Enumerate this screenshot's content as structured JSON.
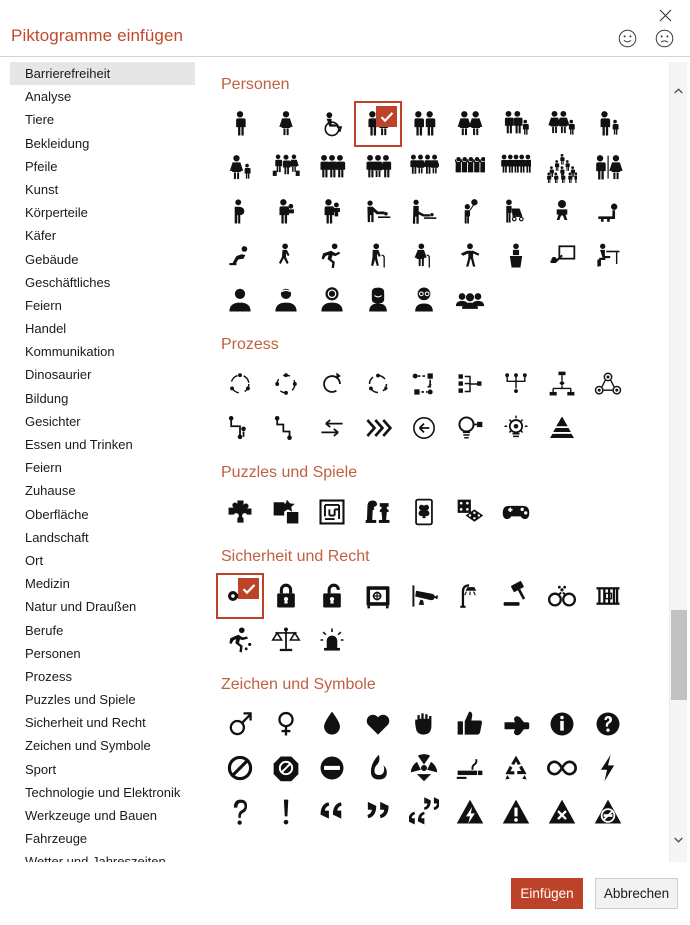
{
  "dialog": {
    "title": "Piktogramme einfügen",
    "close_icon": "close-icon",
    "feedback_happy_icon": "smiley-happy-icon",
    "feedback_sad_icon": "smiley-sad-icon",
    "accent_color": "#C0492B",
    "selection_color": "#BC4328",
    "selected_sidebar_bg": "#e6e6e6"
  },
  "sidebar": {
    "items": [
      {
        "label": "Barrierefreiheit",
        "selected": true
      },
      {
        "label": "Analyse",
        "selected": false
      },
      {
        "label": "Tiere",
        "selected": false
      },
      {
        "label": "Bekleidung",
        "selected": false
      },
      {
        "label": "Pfeile",
        "selected": false
      },
      {
        "label": "Kunst",
        "selected": false
      },
      {
        "label": "Körperteile",
        "selected": false
      },
      {
        "label": "Käfer",
        "selected": false
      },
      {
        "label": "Gebäude",
        "selected": false
      },
      {
        "label": "Geschäftliches",
        "selected": false
      },
      {
        "label": "Feiern",
        "selected": false
      },
      {
        "label": "Handel",
        "selected": false
      },
      {
        "label": "Kommunikation",
        "selected": false
      },
      {
        "label": "Dinosaurier",
        "selected": false
      },
      {
        "label": "Bildung",
        "selected": false
      },
      {
        "label": "Gesichter",
        "selected": false
      },
      {
        "label": "Essen und Trinken",
        "selected": false
      },
      {
        "label": "Feiern",
        "selected": false
      },
      {
        "label": "Zuhause",
        "selected": false
      },
      {
        "label": "Oberfläche",
        "selected": false
      },
      {
        "label": "Landschaft",
        "selected": false
      },
      {
        "label": "Ort",
        "selected": false
      },
      {
        "label": "Medizin",
        "selected": false
      },
      {
        "label": "Natur und Draußen",
        "selected": false
      },
      {
        "label": "Berufe",
        "selected": false
      },
      {
        "label": "Personen",
        "selected": false
      },
      {
        "label": "Prozess",
        "selected": false
      },
      {
        "label": "Puzzles und Spiele",
        "selected": false
      },
      {
        "label": "Sicherheit und Recht",
        "selected": false
      },
      {
        "label": "Zeichen und Symbole",
        "selected": false
      },
      {
        "label": "Sport",
        "selected": false
      },
      {
        "label": "Technologie und Elektronik",
        "selected": false
      },
      {
        "label": "Werkzeuge und Bauen",
        "selected": false
      },
      {
        "label": "Fahrzeuge",
        "selected": false
      },
      {
        "label": "Wetter und Jahreszeiten",
        "selected": false
      }
    ]
  },
  "sections": [
    {
      "title": "Personen",
      "icons": [
        {
          "name": "person-standing-male-icon",
          "selected": false
        },
        {
          "name": "person-standing-female-icon",
          "selected": false
        },
        {
          "name": "person-wheelchair-icon",
          "selected": false
        },
        {
          "name": "couple-two-people-icon",
          "selected": true
        },
        {
          "name": "couple-two-men-icon",
          "selected": false
        },
        {
          "name": "couple-two-women-icon",
          "selected": false
        },
        {
          "name": "family-two-men-child-icon",
          "selected": false
        },
        {
          "name": "family-two-women-child-icon",
          "selected": false
        },
        {
          "name": "parent-and-child-icon",
          "selected": false
        },
        {
          "name": "mother-and-child-icon",
          "selected": false
        },
        {
          "name": "family-with-luggage-icon",
          "selected": false
        },
        {
          "name": "group-of-three-men-icon",
          "selected": false
        },
        {
          "name": "group-of-three-people-icon",
          "selected": false
        },
        {
          "name": "group-of-four-people-icon",
          "selected": false
        },
        {
          "name": "crowd-cheering-icon",
          "selected": false
        },
        {
          "name": "group-of-five-people-icon",
          "selected": false
        },
        {
          "name": "large-crowd-pyramid-icon",
          "selected": false
        },
        {
          "name": "restroom-male-female-icon",
          "selected": false
        },
        {
          "name": "pregnant-person-icon",
          "selected": false
        },
        {
          "name": "adult-holding-baby-icon",
          "selected": false
        },
        {
          "name": "adult-carrying-baby-icon",
          "selected": false
        },
        {
          "name": "changing-baby-diaper-icon",
          "selected": false
        },
        {
          "name": "caring-for-baby-table-icon",
          "selected": false
        },
        {
          "name": "child-with-balloon-icon",
          "selected": false
        },
        {
          "name": "person-pushing-stroller-icon",
          "selected": false
        },
        {
          "name": "baby-sitting-icon",
          "selected": false
        },
        {
          "name": "baby-crawling-icon",
          "selected": false
        },
        {
          "name": "person-crawling-icon",
          "selected": false
        },
        {
          "name": "person-walking-icon",
          "selected": false
        },
        {
          "name": "person-running-icon",
          "selected": false
        },
        {
          "name": "elderly-person-cane-icon",
          "selected": false
        },
        {
          "name": "elderly-woman-cane-icon",
          "selected": false
        },
        {
          "name": "person-arms-open-icon",
          "selected": false
        },
        {
          "name": "person-at-podium-icon",
          "selected": false
        },
        {
          "name": "presenter-with-board-icon",
          "selected": false
        },
        {
          "name": "person-at-desk-icon",
          "selected": false
        },
        {
          "name": "avatar-silhouette-icon",
          "selected": false
        },
        {
          "name": "avatar-man-icon",
          "selected": false
        },
        {
          "name": "avatar-woman-curly-icon",
          "selected": false
        },
        {
          "name": "avatar-woman-long-hair-icon",
          "selected": false
        },
        {
          "name": "avatar-man-glasses-icon",
          "selected": false
        },
        {
          "name": "avatar-group-icon",
          "selected": false
        }
      ]
    },
    {
      "title": "Prozess",
      "icons": [
        {
          "name": "cycle-three-dots-icon",
          "selected": false
        },
        {
          "name": "cycle-four-dots-icon",
          "selected": false
        },
        {
          "name": "refresh-circle-arrows-icon",
          "selected": false
        },
        {
          "name": "cycle-arrows-dots-icon",
          "selected": false
        },
        {
          "name": "process-flow-square-icon",
          "selected": false
        },
        {
          "name": "process-branch-icon",
          "selected": false
        },
        {
          "name": "process-merge-icon",
          "selected": false
        },
        {
          "name": "hierarchy-flow-icon",
          "selected": false
        },
        {
          "name": "network-nodes-icon",
          "selected": false
        },
        {
          "name": "path-zigzag-icon",
          "selected": false
        },
        {
          "name": "path-steps-icon",
          "selected": false
        },
        {
          "name": "exchange-arrows-icon",
          "selected": false
        },
        {
          "name": "fast-forward-chevrons-icon",
          "selected": false
        },
        {
          "name": "back-arrow-circle-icon",
          "selected": false
        },
        {
          "name": "lightbulb-plug-icon",
          "selected": false
        },
        {
          "name": "lightbulb-idea-icon",
          "selected": false
        },
        {
          "name": "pyramid-layers-icon",
          "selected": false
        }
      ]
    },
    {
      "title": "Puzzles und Spiele",
      "icons": [
        {
          "name": "puzzle-pieces-icon",
          "selected": false
        },
        {
          "name": "puzzle-assembly-icon",
          "selected": false
        },
        {
          "name": "maze-icon",
          "selected": false
        },
        {
          "name": "chess-pieces-icon",
          "selected": false
        },
        {
          "name": "playing-card-icon",
          "selected": false
        },
        {
          "name": "dice-icon",
          "selected": false
        },
        {
          "name": "game-controller-icon",
          "selected": false
        }
      ]
    },
    {
      "title": "Sicherheit und Recht",
      "icons": [
        {
          "name": "key-icon",
          "selected": true
        },
        {
          "name": "lock-closed-icon",
          "selected": false
        },
        {
          "name": "lock-open-icon",
          "selected": false
        },
        {
          "name": "safe-vault-icon",
          "selected": false
        },
        {
          "name": "security-camera-icon",
          "selected": false
        },
        {
          "name": "street-lamp-icon",
          "selected": false
        },
        {
          "name": "gavel-icon",
          "selected": false
        },
        {
          "name": "handcuffs-icon",
          "selected": false
        },
        {
          "name": "jail-bars-icon",
          "selected": false
        },
        {
          "name": "emergency-exit-runner-icon",
          "selected": false
        },
        {
          "name": "scales-of-justice-icon",
          "selected": false
        },
        {
          "name": "siren-light-icon",
          "selected": false
        }
      ]
    },
    {
      "title": "Zeichen und Symbole",
      "icons": [
        {
          "name": "male-gender-symbol-icon",
          "selected": false
        },
        {
          "name": "female-gender-symbol-icon",
          "selected": false
        },
        {
          "name": "water-drop-icon",
          "selected": false
        },
        {
          "name": "heart-icon",
          "selected": false
        },
        {
          "name": "open-hand-stop-icon",
          "selected": false
        },
        {
          "name": "thumbs-up-icon",
          "selected": false
        },
        {
          "name": "pointing-hand-icon",
          "selected": false
        },
        {
          "name": "information-circle-icon",
          "selected": false
        },
        {
          "name": "question-mark-circle-icon",
          "selected": false
        },
        {
          "name": "prohibited-slash-icon",
          "selected": false
        },
        {
          "name": "no-entry-octagon-icon",
          "selected": false
        },
        {
          "name": "do-not-enter-bar-icon",
          "selected": false
        },
        {
          "name": "flame-fire-icon",
          "selected": false
        },
        {
          "name": "radiation-icon",
          "selected": false
        },
        {
          "name": "no-smoking-cigarette-icon",
          "selected": false
        },
        {
          "name": "recycle-icon",
          "selected": false
        },
        {
          "name": "infinity-icon",
          "selected": false
        },
        {
          "name": "lightning-bolt-icon",
          "selected": false
        },
        {
          "name": "question-mark-icon",
          "selected": false
        },
        {
          "name": "exclamation-mark-icon",
          "selected": false
        },
        {
          "name": "quote-open-icon",
          "selected": false
        },
        {
          "name": "quote-close-icon",
          "selected": false
        },
        {
          "name": "quotation-marks-icon",
          "selected": false
        },
        {
          "name": "warning-electricity-triangle-icon",
          "selected": false
        },
        {
          "name": "warning-exclamation-triangle-icon",
          "selected": false
        },
        {
          "name": "warning-x-triangle-icon",
          "selected": false
        },
        {
          "name": "warning-no-smoking-triangle-icon",
          "selected": false
        }
      ]
    }
  ],
  "scrollbar": {
    "up_arrow_icon": "chevron-up-icon",
    "down_arrow_icon": "chevron-down-icon",
    "thumb": "scroll-thumb"
  },
  "footer": {
    "insert_label": "Einfügen",
    "cancel_label": "Abbrechen"
  }
}
